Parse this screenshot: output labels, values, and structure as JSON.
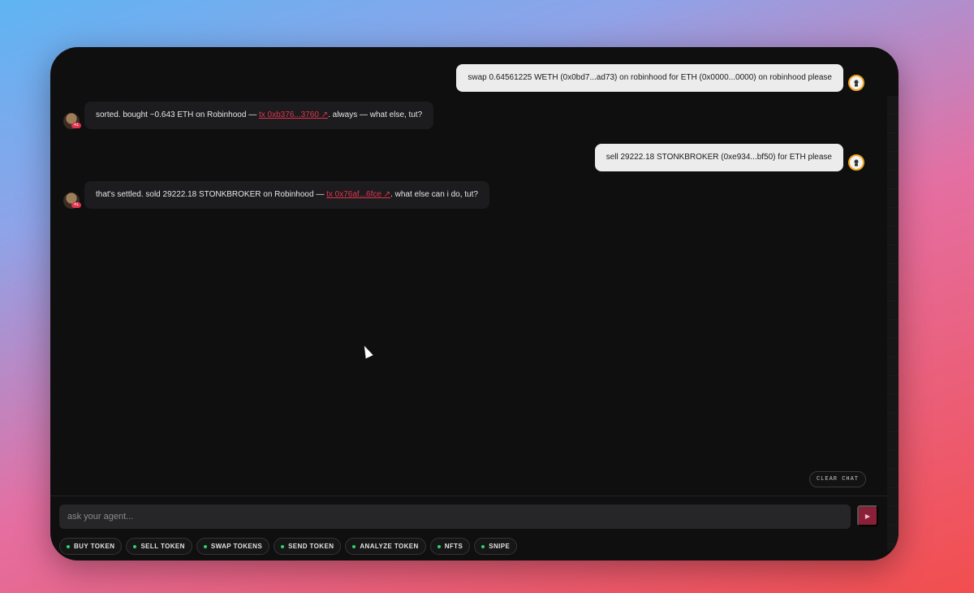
{
  "messages": [
    {
      "role": "user",
      "text": "swap 0.64561225 WETH (0x0bd7...ad73) on robinhood for ETH (0x0000...0000) on robinhood please"
    },
    {
      "role": "agent",
      "text_before": "sorted. bought ~0.643 ETH on Robinhood — ",
      "tx_label": "tx 0xb376...3760 ↗",
      "text_after": ". always — what else, tut?"
    },
    {
      "role": "user",
      "text": "sell 29222.18 STONKBROKER (0xe934...bf50) for ETH please"
    },
    {
      "role": "agent",
      "text_before": "that's settled. sold 29222.18 STONKBROKER on Robinhood — ",
      "tx_label": "tx 0x76af...6fce ↗",
      "text_after": ". what else can i do, tut?"
    }
  ],
  "clear_chat_label": "CLEAR CHAT",
  "input": {
    "placeholder": "ask your agent...",
    "value": ""
  },
  "send_icon": "▶",
  "agent_badge": "41",
  "chips": [
    "BUY TOKEN",
    "SELL TOKEN",
    "SWAP TOKENS",
    "SEND TOKEN",
    "ANALYZE TOKEN",
    "NFTS",
    "SNIPE"
  ],
  "colors": {
    "accent": "#e0344f",
    "send_button": "#8a1f38",
    "chip_dot": "#2bd46b",
    "user_avatar_ring": "#f0a51b"
  }
}
